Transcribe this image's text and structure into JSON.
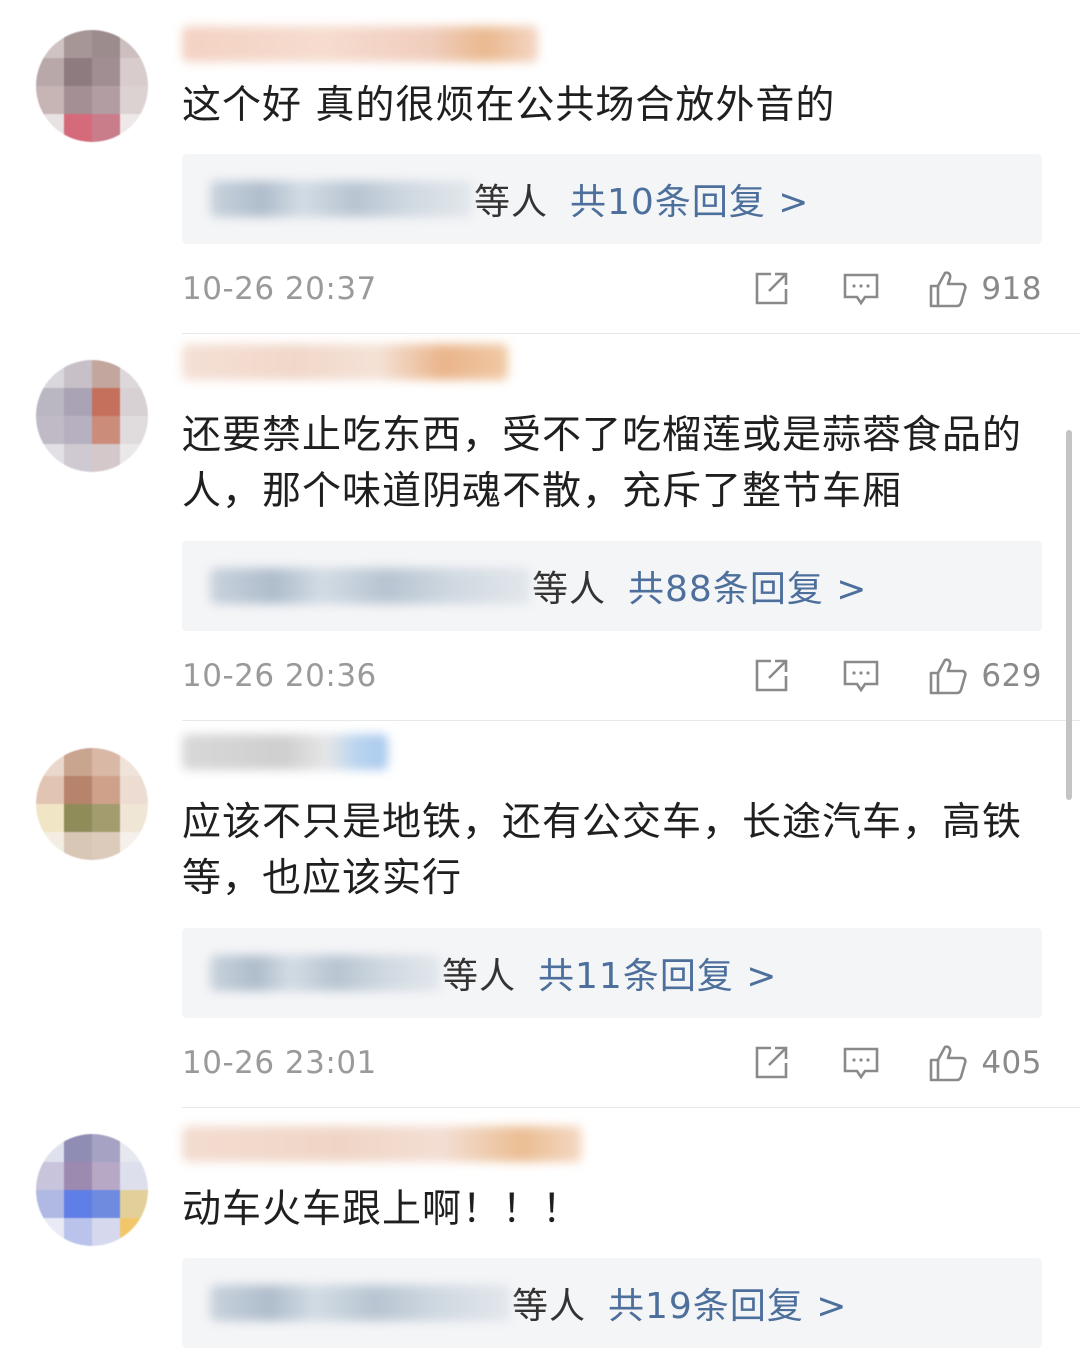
{
  "comments": [
    {
      "text": "这个好 真的很烦在公共场合放外音的",
      "reply_others": "等人",
      "reply_count": "共10条回复 >",
      "time": "10-26 20:37",
      "likes": "918"
    },
    {
      "text": "还要禁止吃东西，受不了吃榴莲或是蒜蓉食品的人，那个味道阴魂不散，充斥了整节车厢",
      "reply_others": "等人",
      "reply_count": "共88条回复 >",
      "time": "10-26 20:36",
      "likes": "629"
    },
    {
      "text": "应该不只是地铁，还有公交车，长途汽车，高铁等，也应该实行",
      "reply_others": "等人",
      "reply_count": "共11条回复 >",
      "time": "10-26 23:01",
      "likes": "405"
    },
    {
      "text": "动车火车跟上啊！！！",
      "reply_others": "等人",
      "reply_count": "共19条回复 >",
      "time": "",
      "likes": ""
    }
  ],
  "icons": {
    "share": "share-icon",
    "reply": "comment-icon",
    "like": "thumbs-up-icon"
  },
  "colors": {
    "reply_link": "#4d6f9c",
    "reply_box_bg": "#f4f5f7",
    "meta_text": "#9a9a9a"
  }
}
